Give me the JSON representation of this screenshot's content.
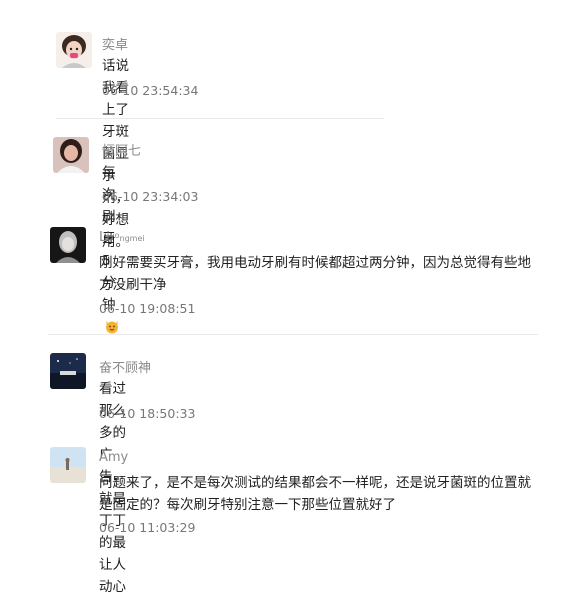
{
  "comments": [
    {
      "name": "奕卓",
      "text": "话说我看上了牙斑菌显示剂，好想用。",
      "time": "06-10 23:54:34",
      "avatar_icon": "girl-cartoon-avatar-icon"
    },
    {
      "name": "恒阿七",
      "text": "每次刷牙5分钟",
      "emoji": "cat-face-emoji",
      "time": "06-10 23:34:03",
      "avatar_icon": "woman-photo-avatar-icon"
    },
    {
      "name": "Li",
      "name_sup": "yo",
      "name_rest": "ngmei",
      "text_line1": "刚好需要买牙膏，我用电动牙刷有时候都超过两分钟，因为总觉得有些地",
      "text_line2": "方没刷干净",
      "time": "06-10 19:08:51",
      "avatar_icon": "dark-portrait-avatar-icon"
    },
    {
      "name": "奋不顾神",
      "text": "看过那么多的广告，就是丁丁的最让人动心",
      "time": "06-10 18:50:33",
      "avatar_icon": "night-city-avatar-icon"
    },
    {
      "name": "Amy",
      "text_line1": "问题来了，是不是每次测试的结果都会不一样呢，还是说牙菌斑的位置就",
      "text_line2": "是固定的？每次刷牙特别注意一下那些位置就好了",
      "time": "06-10 11:03:29",
      "avatar_icon": "beach-avatar-icon"
    }
  ],
  "colors": {
    "name": "#8a8a8a",
    "text": "#222222",
    "time": "#777777",
    "divider": "#e9e9e9"
  }
}
